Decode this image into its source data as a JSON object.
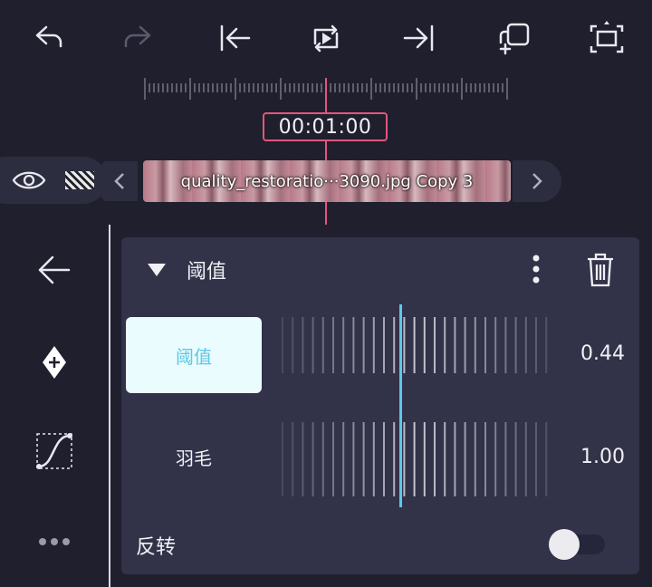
{
  "toolbar": {
    "undo_icon": "undo-icon",
    "redo_icon": "redo-icon",
    "jump_start_icon": "jump-to-start-icon",
    "loop_play_icon": "loop-play-icon",
    "jump_end_icon": "jump-to-end-icon",
    "add_copy_icon": "add-copy-icon",
    "fullscreen_icon": "fullscreen-icon"
  },
  "timeline": {
    "timecode": "00:01:00",
    "clip_label": "quality_restoratio···3090.jpg Copy 3"
  },
  "sidebar": {
    "back_icon": "back-arrow-icon",
    "keyframe_icon": "add-keyframe-icon",
    "curve_icon": "bezier-curve-icon",
    "more_icon": "more-horizontal-icon"
  },
  "panel": {
    "title": "阈值",
    "params": [
      {
        "label": "阈值",
        "value": "0.44",
        "selected": true
      },
      {
        "label": "羽毛",
        "value": "1.00",
        "selected": false
      }
    ],
    "reverse_label": "反转",
    "reverse_on": false
  },
  "colors": {
    "background": "#1f1f2e",
    "panel": "#323249",
    "accent_playhead": "#e2577a",
    "slider_indicator": "#5ec8e8",
    "selected_bg": "#eafcfd",
    "selected_text": "#5ec8e8"
  }
}
